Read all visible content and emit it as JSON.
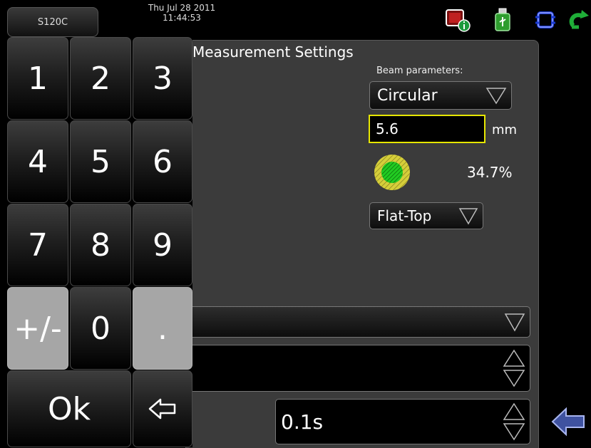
{
  "header": {
    "device": "S120C",
    "date": "Thu Jul 28 2011",
    "time": "11:44:53"
  },
  "icons": {
    "top": [
      "display-info-icon",
      "usb-icon",
      "connection-icon",
      "refresh-icon"
    ],
    "back": "back-arrow-icon"
  },
  "settings": {
    "title": "Measurement Settings",
    "beam_label": "Beam parameters:",
    "shape": "Circular",
    "diameter": "5.6",
    "unit": "mm",
    "coverage": "34.7%",
    "profile": "Flat-Top",
    "averaging": "0.1s"
  },
  "keypad": {
    "keys": [
      "1",
      "2",
      "3",
      "4",
      "5",
      "6",
      "7",
      "8",
      "9",
      "+/-",
      "0",
      "."
    ],
    "ok": "Ok",
    "backspace": "⇦"
  },
  "colors": {
    "highlight": "#e6e600",
    "accent_green": "#22cc22",
    "beam_yellow": "#d6cf3a",
    "back_blue": "#3f52a0"
  }
}
